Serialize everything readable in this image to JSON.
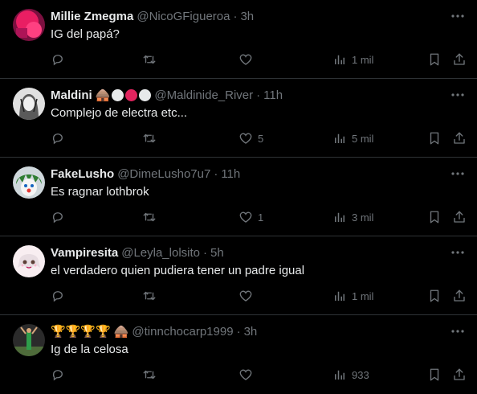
{
  "tweets": [
    {
      "name": "Millie Zmegma",
      "handle": "@NicoGFigueroa",
      "separator": "·",
      "time": "3h",
      "text": "IG del papá?",
      "replies": "",
      "retweets": "",
      "likes": "",
      "views": "1 mil",
      "avatar_color": "#c2185b",
      "badges": []
    },
    {
      "name": "Maldini",
      "handle": "@Maldinide_River",
      "separator": "·",
      "time": "11h",
      "text": "Complejo de electra etc...",
      "replies": "",
      "retweets": "",
      "likes": "5",
      "views": "5 mil",
      "avatar_color": "#d8d8d8",
      "badges": [
        "house-emoji",
        "white-circle",
        "red-circle",
        "white-circle"
      ]
    },
    {
      "name": "FakeLusho",
      "handle": "@DimeLusho7u7",
      "separator": "·",
      "time": "11h",
      "text": "Es ragnar lothbrok",
      "replies": "",
      "retweets": "",
      "likes": "1",
      "views": "3 mil",
      "avatar_color": "#2e7d32",
      "badges": []
    },
    {
      "name": "Vampiresita",
      "handle": "@Leyla_lolsito",
      "separator": "·",
      "time": "5h",
      "text": "el verdadero quien pudiera tener un padre igual",
      "replies": "",
      "retweets": "",
      "likes": "",
      "views": "1 mil",
      "avatar_color": "#f2e9ec",
      "badges": []
    },
    {
      "name": "🏆🏆🏆🏆",
      "handle": "@tinnchocarp1999",
      "separator": "·",
      "time": "3h",
      "text": "Ig de la celosa",
      "replies": "",
      "retweets": "",
      "likes": "",
      "views": "933",
      "avatar_color": "#3a3a3a",
      "badges": [
        "house-emoji"
      ]
    }
  ],
  "colors": {
    "background": "#000000",
    "text": "#e7e9ea",
    "muted": "#71767b",
    "divider": "#2f3336",
    "badge_red": "#e0245e"
  }
}
